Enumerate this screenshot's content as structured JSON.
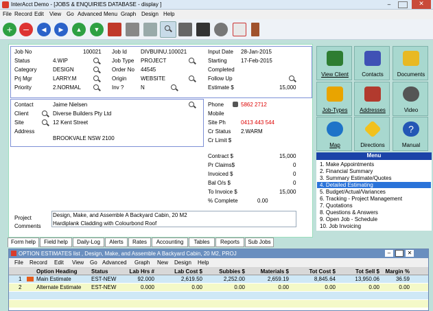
{
  "window": {
    "title": "InterAcct Demo - [JOBS & ENQUIRIES DATABASE - display ]"
  },
  "menu": [
    "File",
    "Record",
    "Edit",
    "View",
    "Go",
    "Advanced",
    "Menu",
    "Graph",
    "Design",
    "Help"
  ],
  "toolbar": [
    "add-icon",
    "delete-icon",
    "first-record-icon",
    "last-record-icon",
    "previous-record-icon",
    "next-record-icon",
    "home-icon",
    "print-icon",
    "fax-icon",
    "search-icon",
    "keyboard-icon",
    "monitor-icon",
    "gear-icon",
    "calendar-icon",
    "exit-door-icon"
  ],
  "job": {
    "job_no_label": "Job No",
    "job_no": "100021",
    "job_id_label": "Job Id",
    "job_id": "DIVBUINU.100021",
    "input_date_label": "Input Date",
    "input_date": "28-Jan-2015",
    "status_label": "Status",
    "status": "4.WIP",
    "job_type_label": "Job Type",
    "job_type": "PROJECT",
    "starting_label": "Starting",
    "starting": "17-Feb-2015",
    "category_label": "Category",
    "category": "DESIGN",
    "order_no_label": "Order No",
    "order_no": "44545",
    "completed_label": "Completed",
    "prj_mgr_label": "Prj Mgr",
    "prj_mgr": "LARRY.M",
    "origin_label": "Origin",
    "origin": "WEBSITE",
    "follow_up_label": "Follow Up",
    "priority_label": "Priority",
    "priority": "2.NORMAL",
    "inv_label": "Inv ?",
    "inv": "N",
    "estimate_label": "Estimate $",
    "estimate": "15,000"
  },
  "contact": {
    "contact_label": "Contact",
    "contact": "Jaime Nielsen",
    "client_label": "Client",
    "client": "Diverse Builders Pty Ltd",
    "site_label": "Site",
    "site": "12 Kent Street",
    "address_label": "Address",
    "address": "BROOKVALE NSW 2100",
    "phone_label": "Phone",
    "phone": "5862 2712",
    "mobile_label": "Mobile",
    "site_ph_label": "Site Ph",
    "site_ph": "0413 443 544",
    "cr_status_label": "Cr Status",
    "cr_status": "2.WARM",
    "cr_limit_label": "Cr Limit $"
  },
  "financials": [
    {
      "label": "Contract $",
      "value": "15,000"
    },
    {
      "label": "Pr Claims$",
      "value": "0"
    },
    {
      "label": "Invoiced $",
      "value": "0"
    },
    {
      "label": "Bal O/s $",
      "value": "0"
    },
    {
      "label": "To Invoice $",
      "value": "15,000"
    },
    {
      "label": "% Complete",
      "value": "0.00"
    }
  ],
  "project": {
    "project_label": "Project",
    "project": "Design, Make, and Assemble A Backyard Cabin, 20 M2",
    "comments_label": "Comments",
    "comments": "Hardiplank Cladding with Colourbond Roof"
  },
  "tiles": [
    {
      "label": "View Client",
      "icon": "people-icon",
      "color": "#2e7d32"
    },
    {
      "label": "Contacts",
      "icon": "contacts-icon",
      "color": "#3f51b5"
    },
    {
      "label": "Documents",
      "icon": "folder-icon",
      "color": "#e8b923"
    },
    {
      "label": "Job-Types",
      "icon": "hardhat-icon",
      "color": "#e9a400"
    },
    {
      "label": "Addresses",
      "icon": "houses-icon",
      "color": "#b23a2e"
    },
    {
      "label": "Video",
      "icon": "film-reel-icon",
      "color": "#555555"
    },
    {
      "label": "Map",
      "icon": "globe-icon",
      "color": "#1e73c8"
    },
    {
      "label": "Directions",
      "icon": "road-sign-icon",
      "color": "#f2c11d"
    },
    {
      "label": "Manual",
      "icon": "help-icon",
      "color": "#2457b5"
    }
  ],
  "side_menu": {
    "title": "Menu",
    "items": [
      "1. Make Appointments",
      "2. Financial Summary",
      "3. Summary Estimate/Quotes",
      "4. Detailed Estimating",
      "5. Budget/Actual/Variances",
      "6. Tracking - Project Management",
      "7. Quotations",
      "8. Questions & Answers",
      "9. Open Job - Schedule",
      "10. Job Invoicing"
    ],
    "selected": "4. Detailed Estimating"
  },
  "tabs": [
    "Form help",
    "Field help",
    "Daily-Log",
    "Alerts",
    "Rates",
    "Accounting",
    "Tables",
    "Reports",
    "Sub Jobs"
  ],
  "subwindow": {
    "title": "OPTION ESTIMATES list , Design, Make, and Assemble A Backyard Cabin, 20 M2, PROJ",
    "menu": [
      "File",
      "Record",
      "Edit",
      "View",
      "Go",
      "Advanced",
      "Graph",
      "New",
      "Design",
      "Help"
    ],
    "columns": [
      "Option Heading",
      "Status",
      "Lab Hrs #",
      "Lab Cost $",
      "Subbies $",
      "Materials $",
      "Tot Cost $",
      "Tot Sell $",
      "Margin %"
    ],
    "rows": [
      {
        "n": "1",
        "heading": "Main Estimate",
        "status": "EST-NEW",
        "lab_hrs": "92.000",
        "lab_cost": "2,619.50",
        "subbies": "2,252.00",
        "materials": "2,659.19",
        "tot_cost": "8,845.64",
        "tot_sell": "13,950.06",
        "margin": "36.59"
      },
      {
        "n": "2",
        "heading": "Alternate Estimate",
        "status": "EST-NEW",
        "lab_hrs": "0.000",
        "lab_cost": "0.00",
        "subbies": "0.00",
        "materials": "0.00",
        "tot_cost": "0.00",
        "tot_sell": "0.00",
        "margin": "0.00"
      }
    ]
  }
}
